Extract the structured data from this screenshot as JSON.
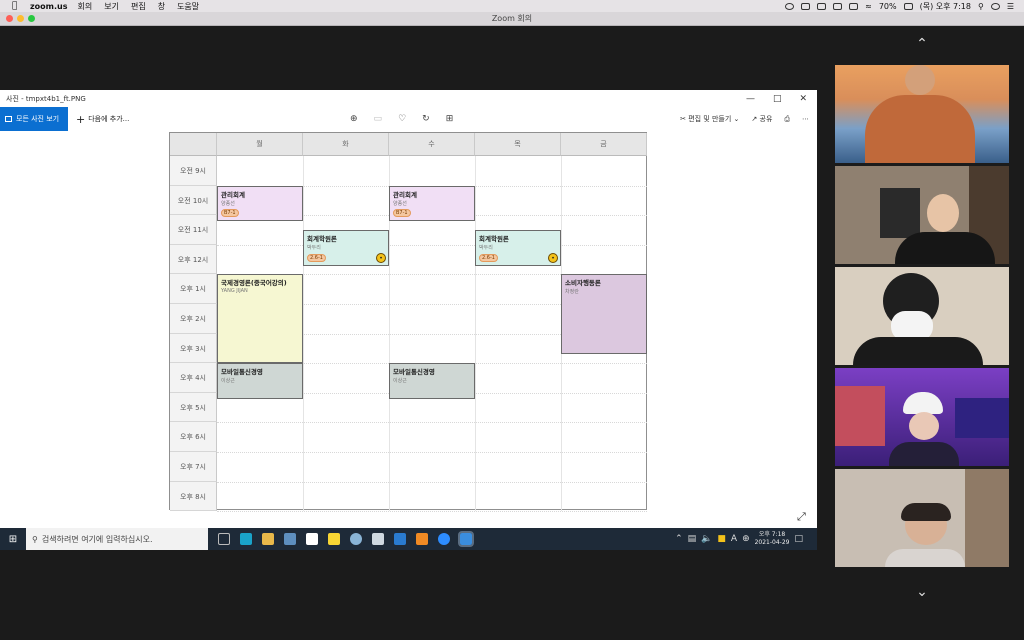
{
  "mac": {
    "app": "zoom.us",
    "menus": [
      "회의",
      "보기",
      "편집",
      "창",
      "도움말"
    ],
    "battery": "70%",
    "clock": "(목) 오후 7:18"
  },
  "zoom": {
    "title": "Zoom 회의"
  },
  "photos": {
    "title": "사진 - tmpxt4b1_ft.PNG",
    "all_photos": "모든 사진 보기",
    "add_to": "다음에 추가...",
    "edit_create": "편집 및 만들기",
    "share": "공유"
  },
  "timetable": {
    "days": [
      "월",
      "화",
      "수",
      "목",
      "금"
    ],
    "times": [
      "오전 9시",
      "오전 10시",
      "오전 11시",
      "오후 12시",
      "오후 1시",
      "오후 2시",
      "오후 3시",
      "오후 4시",
      "오후 5시",
      "오후 6시",
      "오후 7시",
      "오후 8시"
    ],
    "classes": [
      {
        "name": "관리회계",
        "prof": "양종선",
        "tag": "B7-1",
        "day": 0,
        "start": 1,
        "end": 2.2,
        "color": "#f1dff5"
      },
      {
        "name": "관리회계",
        "prof": "양종선",
        "tag": "B7-1",
        "day": 2,
        "start": 1,
        "end": 2.2,
        "color": "#f1dff5"
      },
      {
        "name": "회계학원론",
        "prof": "박두리",
        "tag": "2.6-1",
        "day": 1,
        "start": 2.5,
        "end": 3.7,
        "color": "#d7f0ea"
      },
      {
        "name": "회계학원론",
        "prof": "박두리",
        "tag": "2.6-1",
        "day": 3,
        "start": 2.5,
        "end": 3.7,
        "color": "#d7f0ea"
      },
      {
        "name": "국제경영론(중국어강의)",
        "prof": "YANG JIJAN",
        "tag": "",
        "day": 0,
        "start": 4,
        "end": 7,
        "color": "#f6f7d2"
      },
      {
        "name": "소비자행동론",
        "prof": "차정란",
        "tag": "",
        "day": 4,
        "start": 4,
        "end": 6.7,
        "color": "#dcc8df"
      },
      {
        "name": "모바일통신경영",
        "prof": "이상근",
        "tag": "",
        "day": 0,
        "start": 7,
        "end": 8.2,
        "color": "#cfd7d4"
      },
      {
        "name": "모바일통신경영",
        "prof": "이상근",
        "tag": "",
        "day": 2,
        "start": 7,
        "end": 8.2,
        "color": "#cfd7d4"
      }
    ]
  },
  "taskbar": {
    "search_placeholder": "검색하려면 여기에 입력하십시오.",
    "tray_lang": "A",
    "time": "오후 7:18",
    "date": "2021-04-29"
  },
  "participants": 5
}
